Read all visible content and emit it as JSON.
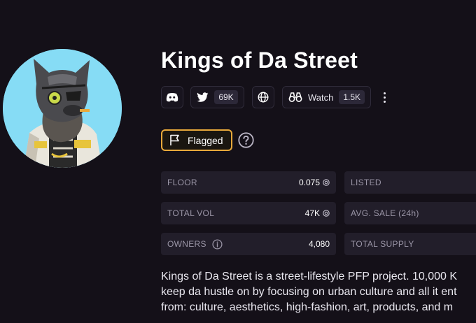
{
  "collection": {
    "title": "Kings of Da Street",
    "avatar_icon": "wolf-pfp-avatar"
  },
  "social": {
    "discord_icon": "discord-icon",
    "twitter_icon": "twitter-icon",
    "twitter_count": "69K",
    "website_icon": "globe-icon",
    "watch_label": "Watch",
    "watch_count": "1.5K",
    "more_icon": "more-vertical-icon"
  },
  "flag": {
    "label": "Flagged",
    "flag_icon": "flag-icon",
    "help_icon": "question-circle-icon",
    "accent": "#e8a93b"
  },
  "stats": [
    {
      "label": "FLOOR",
      "value": "0.075"
    },
    {
      "label": "LISTED",
      "value": ""
    },
    {
      "label": "TOTAL VOL",
      "value": "47K"
    },
    {
      "label": "AVG. SALE (24h)",
      "value": ""
    },
    {
      "label": "OWNERS",
      "value": "4,080"
    },
    {
      "label": "TOTAL SUPPLY",
      "value": ""
    }
  ],
  "description": {
    "lines": [
      "Kings of Da Street is a street-lifestyle PFP project. 10,000 K",
      "keep da hustle on by focusing on urban culture and all it ent",
      "from: culture, aesthetics, high-fashion, art, products, and m"
    ]
  },
  "colors": {
    "background": "#141018",
    "card": "#221e2a",
    "avatar_bg": "#86dcf5"
  }
}
